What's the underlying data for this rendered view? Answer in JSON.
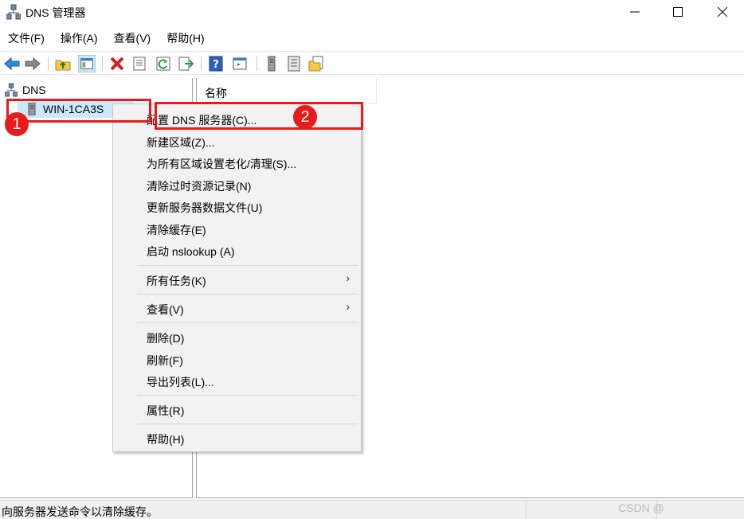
{
  "window": {
    "title": "DNS 管理器",
    "minimize_icon": "minimize-icon",
    "maximize_icon": "maximize-icon",
    "close_icon": "close-icon"
  },
  "menubar": {
    "items": [
      "文件(F)",
      "操作(A)",
      "查看(V)",
      "帮助(H)"
    ]
  },
  "toolbar": {
    "icons": [
      "back-arrow-icon",
      "forward-arrow-icon",
      "up-folder-icon",
      "show-hide-tree-icon",
      "delete-icon",
      "properties-icon",
      "refresh-icon",
      "export-list-icon",
      "help-icon",
      "console-icon",
      "server-icon",
      "list-icon",
      "folder-copy-icon"
    ]
  },
  "tree": {
    "root_label": "DNS",
    "server_label": "WIN-1CA3S"
  },
  "list_pane": {
    "column_name": "名称"
  },
  "context_menu": {
    "items": {
      "configure": "配置 DNS 服务器(C)...",
      "new_zone": "新建区域(Z)...",
      "aging": "为所有区域设置老化/清理(S)...",
      "scavenge": "清除过时资源记录(N)",
      "update_files": "更新服务器数据文件(U)",
      "clear_cache": "清除缓存(E)",
      "nslookup": "启动 nslookup (A)",
      "all_tasks": "所有任务(K)",
      "view": "查看(V)",
      "delete": "删除(D)",
      "refresh": "刷新(F)",
      "export": "导出列表(L)...",
      "properties": "属性(R)",
      "help": "帮助(H)"
    },
    "submenu_arrow": "›"
  },
  "annotations": {
    "badge1": "1",
    "badge2": "2",
    "color": "#e81a1a"
  },
  "statusbar": {
    "text": "向服务器发送命令以清除缓存。",
    "watermark": "CSDN @"
  },
  "colors": {
    "selection": "#cce8ff",
    "menu_bg": "#f2f2f2",
    "accent_blue": "#1f6fd1"
  }
}
